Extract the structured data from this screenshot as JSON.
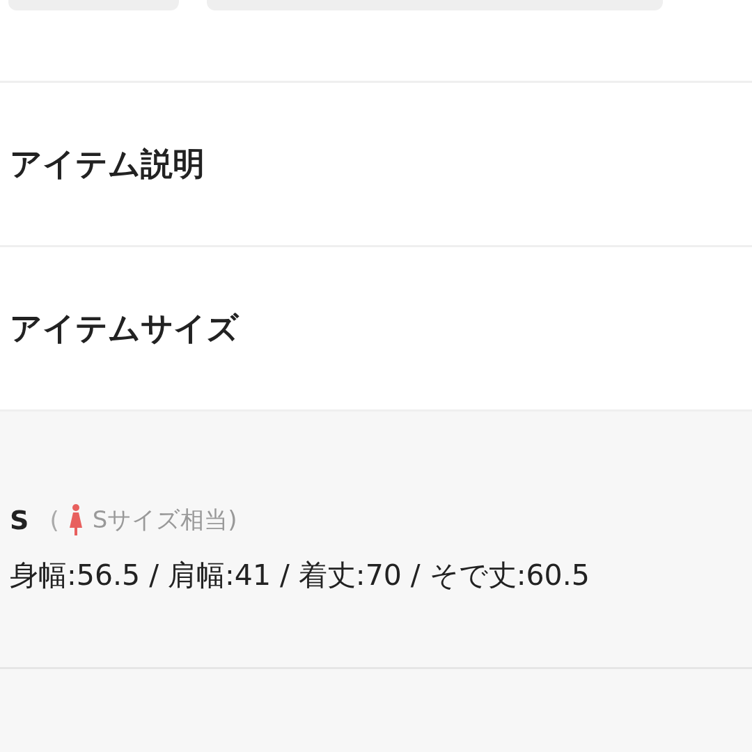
{
  "sections": [
    {
      "title": "アイテム説明"
    },
    {
      "title": "アイテムサイズ"
    }
  ],
  "sizes": [
    {
      "label": "S",
      "paren": "(",
      "equivalent": "Sサイズ相当)",
      "measurements": "身幅:56.5 / 肩幅:41 / 着丈:70 / そで丈:60.5"
    }
  ]
}
